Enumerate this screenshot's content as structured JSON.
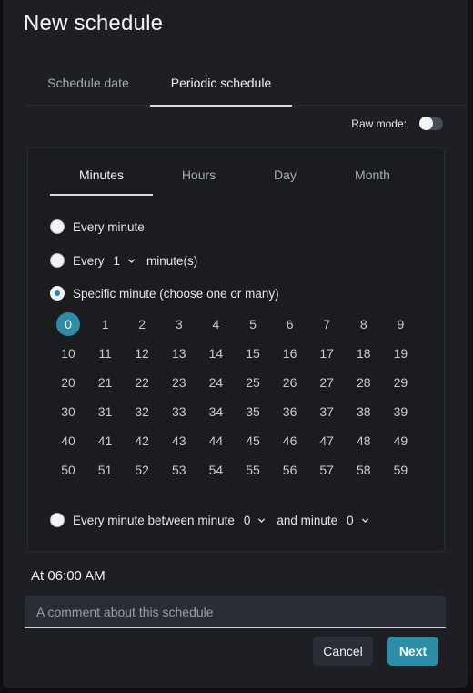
{
  "dialog": {
    "title": "New schedule"
  },
  "main_tabs": [
    {
      "label": "Schedule date",
      "active": false
    },
    {
      "label": "Periodic schedule",
      "active": true
    }
  ],
  "raw_mode": {
    "label": "Raw mode:",
    "enabled": false
  },
  "sub_tabs": [
    {
      "label": "Minutes",
      "active": true
    },
    {
      "label": "Hours",
      "active": false
    },
    {
      "label": "Day",
      "active": false
    },
    {
      "label": "Month",
      "active": false
    }
  ],
  "options": {
    "every_minute": {
      "label": "Every minute",
      "checked": false
    },
    "every_n": {
      "checked": false,
      "prefix": "Every",
      "value": "1",
      "suffix": "minute(s)"
    },
    "specific": {
      "label": "Specific minute (choose one or many)",
      "checked": true,
      "selected": [
        "0"
      ]
    },
    "between": {
      "checked": false,
      "prefix": "Every minute between minute",
      "from": "0",
      "middle": "and minute",
      "to": "0"
    }
  },
  "minutes": [
    "0",
    "1",
    "2",
    "3",
    "4",
    "5",
    "6",
    "7",
    "8",
    "9",
    "10",
    "11",
    "12",
    "13",
    "14",
    "15",
    "16",
    "17",
    "18",
    "19",
    "20",
    "21",
    "22",
    "23",
    "24",
    "25",
    "26",
    "27",
    "28",
    "29",
    "30",
    "31",
    "32",
    "33",
    "34",
    "35",
    "36",
    "37",
    "38",
    "39",
    "40",
    "41",
    "42",
    "43",
    "44",
    "45",
    "46",
    "47",
    "48",
    "49",
    "50",
    "51",
    "52",
    "53",
    "54",
    "55",
    "56",
    "57",
    "58",
    "59"
  ],
  "summary": "At 06:00 AM",
  "comment": {
    "value": "",
    "placeholder": "A comment about this schedule"
  },
  "actions": {
    "cancel": "Cancel",
    "next": "Next"
  },
  "colors": {
    "accent": "#2a8ea6",
    "background": "#1d1f24"
  }
}
